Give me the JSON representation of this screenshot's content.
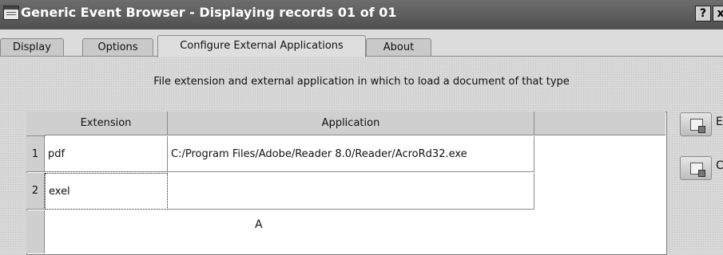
{
  "window": {
    "title": "Generic Event Browser - Displaying records 01 of 01",
    "help_label": "?",
    "close_label": "x"
  },
  "tabs": [
    {
      "label": "Display"
    },
    {
      "label": "Options"
    },
    {
      "label": "Configure External Applications",
      "active": true
    },
    {
      "label": "About"
    }
  ],
  "panel": {
    "description": "File extension and external application in which to load a document of that type"
  },
  "table": {
    "columns": [
      "Extension",
      "Application"
    ],
    "rows": [
      {
        "num": "1",
        "extension": "pdf",
        "application": "C:/Program Files/Adobe/Reader 8.0/Reader/AcroRd32.exe"
      },
      {
        "num": "2",
        "extension": "exel",
        "application": ""
      }
    ]
  },
  "annotation": "A",
  "side_buttons": [
    {
      "label": "E",
      "icon": "edit-icon"
    },
    {
      "label": "C",
      "icon": "clear-icon"
    }
  ]
}
